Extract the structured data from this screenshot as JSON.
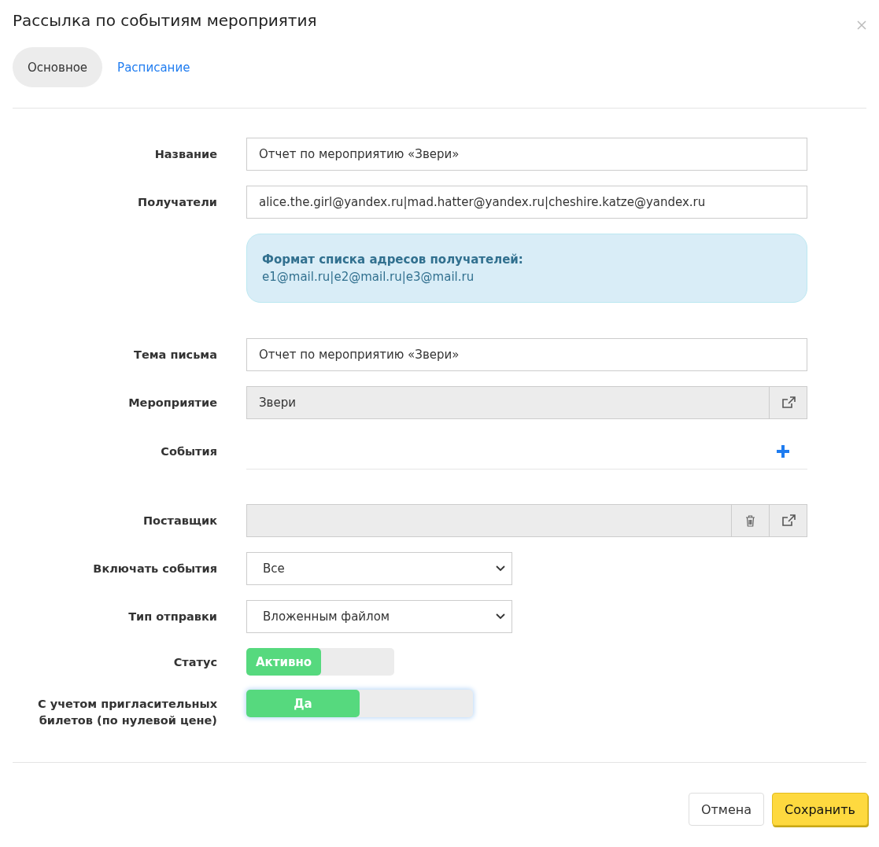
{
  "dialog": {
    "title": "Рассылка по событиям мероприятия"
  },
  "tabs": [
    {
      "label": "Основное",
      "selected": true
    },
    {
      "label": "Расписание",
      "selected": false
    }
  ],
  "fields": [
    {
      "kind": "text",
      "label": "Название",
      "value": "Отчет по мероприятию «Звери»"
    },
    {
      "kind": "text",
      "label": "Получатели",
      "value": "alice.the.girl@yandex.ru|mad.hatter@yandex.ru|cheshire.katze@yandex.ru"
    },
    {
      "kind": "info",
      "heading": "Формат списка адресов получателей:",
      "text": "e1@mail.ru|e2@mail.ru|e3@mail.ru"
    },
    {
      "kind": "text",
      "label": "Тема письма",
      "value": "Отчет по мероприятию «Звери»"
    },
    {
      "kind": "readonly",
      "label": "Мероприятие",
      "value": "Звери",
      "delete": false
    },
    {
      "kind": "events",
      "label": "События"
    },
    {
      "kind": "readonly",
      "label": "Поставщик",
      "delete": true
    },
    {
      "kind": "select",
      "label": "Включать события",
      "value": "Все"
    },
    {
      "kind": "select",
      "label": "Тип отправки",
      "value": "Вложенным файлом"
    },
    {
      "kind": "toggle",
      "label": "Статус",
      "value": "Активно",
      "on": true,
      "wide": false,
      "focused": false
    },
    {
      "kind": "toggle",
      "label": "С учетом пригласительных билетов (по нулевой цене)",
      "value": "Да",
      "on": true,
      "wide": true,
      "focused": true
    }
  ],
  "buttons": [
    {
      "label": "Отмена",
      "kind": "secondary"
    },
    {
      "label": "Сохранить",
      "kind": "primary"
    }
  ]
}
